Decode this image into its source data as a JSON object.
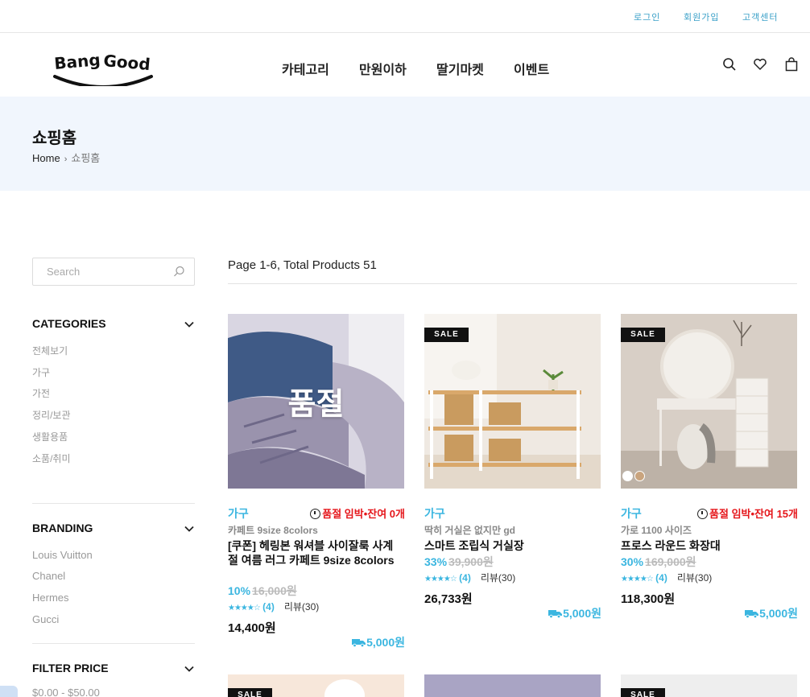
{
  "topbar": {
    "login": "로그인",
    "signup": "회원가입",
    "support": "고객센터"
  },
  "header": {
    "logo_text": "Bang Good",
    "nav": [
      "카테고리",
      "만원이하",
      "딸기마켓",
      "이벤트"
    ]
  },
  "hero": {
    "title": "쇼핑홈",
    "breadcrumb_home": "Home",
    "breadcrumb_current": "쇼핑홈"
  },
  "sidebar": {
    "search_placeholder": "Search",
    "categories_title": "CATEGORIES",
    "categories": [
      "전체보기",
      "가구",
      "가전",
      "정리/보관",
      "생활용품",
      "소품/취미"
    ],
    "branding_title": "BRANDING",
    "brands": [
      "Louis Vuitton",
      "Chanel",
      "Hermes",
      "Gucci"
    ],
    "filter_title": "FILTER PRICE",
    "price_ranges": [
      "$0.00 - $50.00"
    ]
  },
  "summary": "Page 1-6, Total Products 51",
  "products": [
    {
      "category": "가구",
      "stock": "품절 임박•잔여 0개",
      "subtitle": "카페트 9size 8colors",
      "name": "[쿠폰] 헤링본 워셔블 사이잘룩 사계절 여름 러그 카페트 9size 8colors",
      "discount": "10%",
      "original_price": "16,000원",
      "rating": 4,
      "rating_count": "(4)",
      "review": "리뷰(30)",
      "price": "14,400원",
      "shipping": "5,000원",
      "sold_out_label": "품절",
      "sale": false
    },
    {
      "category": "가구",
      "stock": "",
      "subtitle": "딱히 거실은 없지만 gd",
      "name": "스마트 조립식 거실장",
      "discount": "33%",
      "original_price": "39,900원",
      "rating": 4,
      "rating_count": "(4)",
      "review": "리뷰(30)",
      "price": "26,733원",
      "shipping": "5,000원",
      "sale": true,
      "sale_label": "SALE"
    },
    {
      "category": "가구",
      "stock": "품절 임박•잔여 15개",
      "subtitle": "가로 1100 사이즈",
      "name": "프로스 라운드 화장대",
      "discount": "30%",
      "original_price": "169,000원",
      "rating": 4,
      "rating_count": "(4)",
      "review": "리뷰(30)",
      "price": "118,300원",
      "shipping": "5,000원",
      "sale": true,
      "sale_label": "SALE",
      "swatch_colors": [
        "#ffffff",
        "#c9a47e"
      ]
    }
  ],
  "next_row": {
    "sale_label": "SALE"
  },
  "colors": {
    "accent": "#3bb6e0",
    "alert": "#e5161b",
    "hero_bg": "#f1f6fd"
  }
}
